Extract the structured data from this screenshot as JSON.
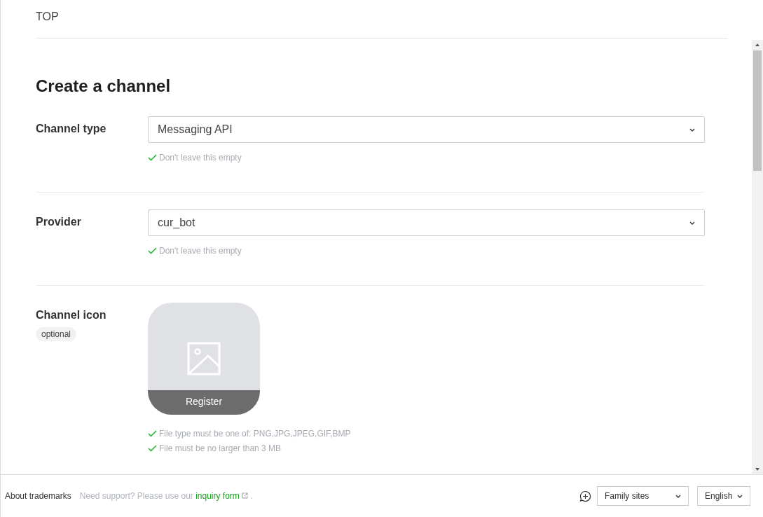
{
  "breadcrumb": "TOP",
  "title": "Create a channel",
  "fields": [
    {
      "kind": "select",
      "label": "Channel type",
      "value": "Messaging API",
      "hints": [
        "Don't leave this empty"
      ]
    },
    {
      "kind": "select",
      "label": "Provider",
      "value": "cur_bot",
      "hints": [
        "Don't leave this empty"
      ]
    },
    {
      "kind": "image",
      "label": "Channel icon",
      "badge": "optional",
      "button": "Register",
      "hints": [
        "File type must be one of: PNG,JPG,JPEG,GIF,BMP",
        "File must be no larger than 3 MB"
      ]
    }
  ],
  "footer": {
    "trademarks": "About trademarks",
    "support_text": "Need support? Please use our ",
    "support_link": "inquiry form",
    "support_end": ".",
    "family_sites": "Family sites",
    "language": "English"
  }
}
